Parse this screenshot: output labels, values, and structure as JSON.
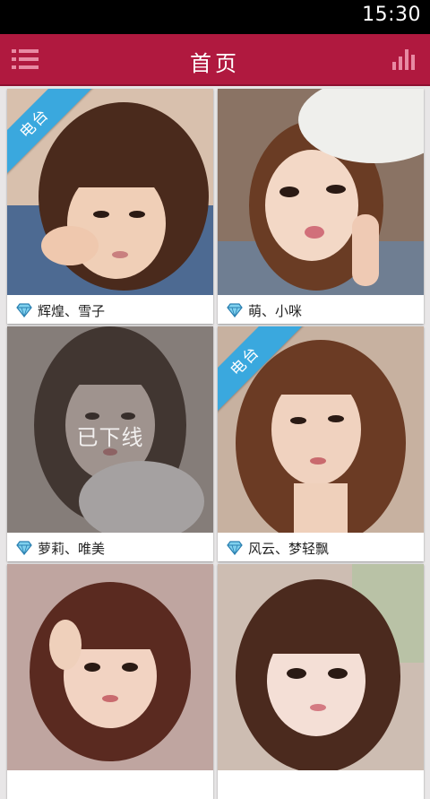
{
  "status_bar": {
    "time": "15:30"
  },
  "header": {
    "title": "首页",
    "menu_icon": "list-menu-icon",
    "right_icon": "bar-chart-icon"
  },
  "colors": {
    "header_bg": "#b0193f",
    "ribbon": "#3aa8de",
    "background": "#e8e6e7"
  },
  "cards": [
    {
      "name": "辉煌、雪子",
      "ribbon": "电台",
      "offline": ""
    },
    {
      "name": "萌、小咪",
      "ribbon": "",
      "offline": ""
    },
    {
      "name": "萝莉、唯美",
      "ribbon": "",
      "offline": "已下线"
    },
    {
      "name": "风云、梦轻飘",
      "ribbon": "电台",
      "offline": ""
    },
    {
      "name": "",
      "ribbon": "",
      "offline": ""
    },
    {
      "name": "",
      "ribbon": "",
      "offline": ""
    }
  ],
  "card_icon": "diamond-icon"
}
